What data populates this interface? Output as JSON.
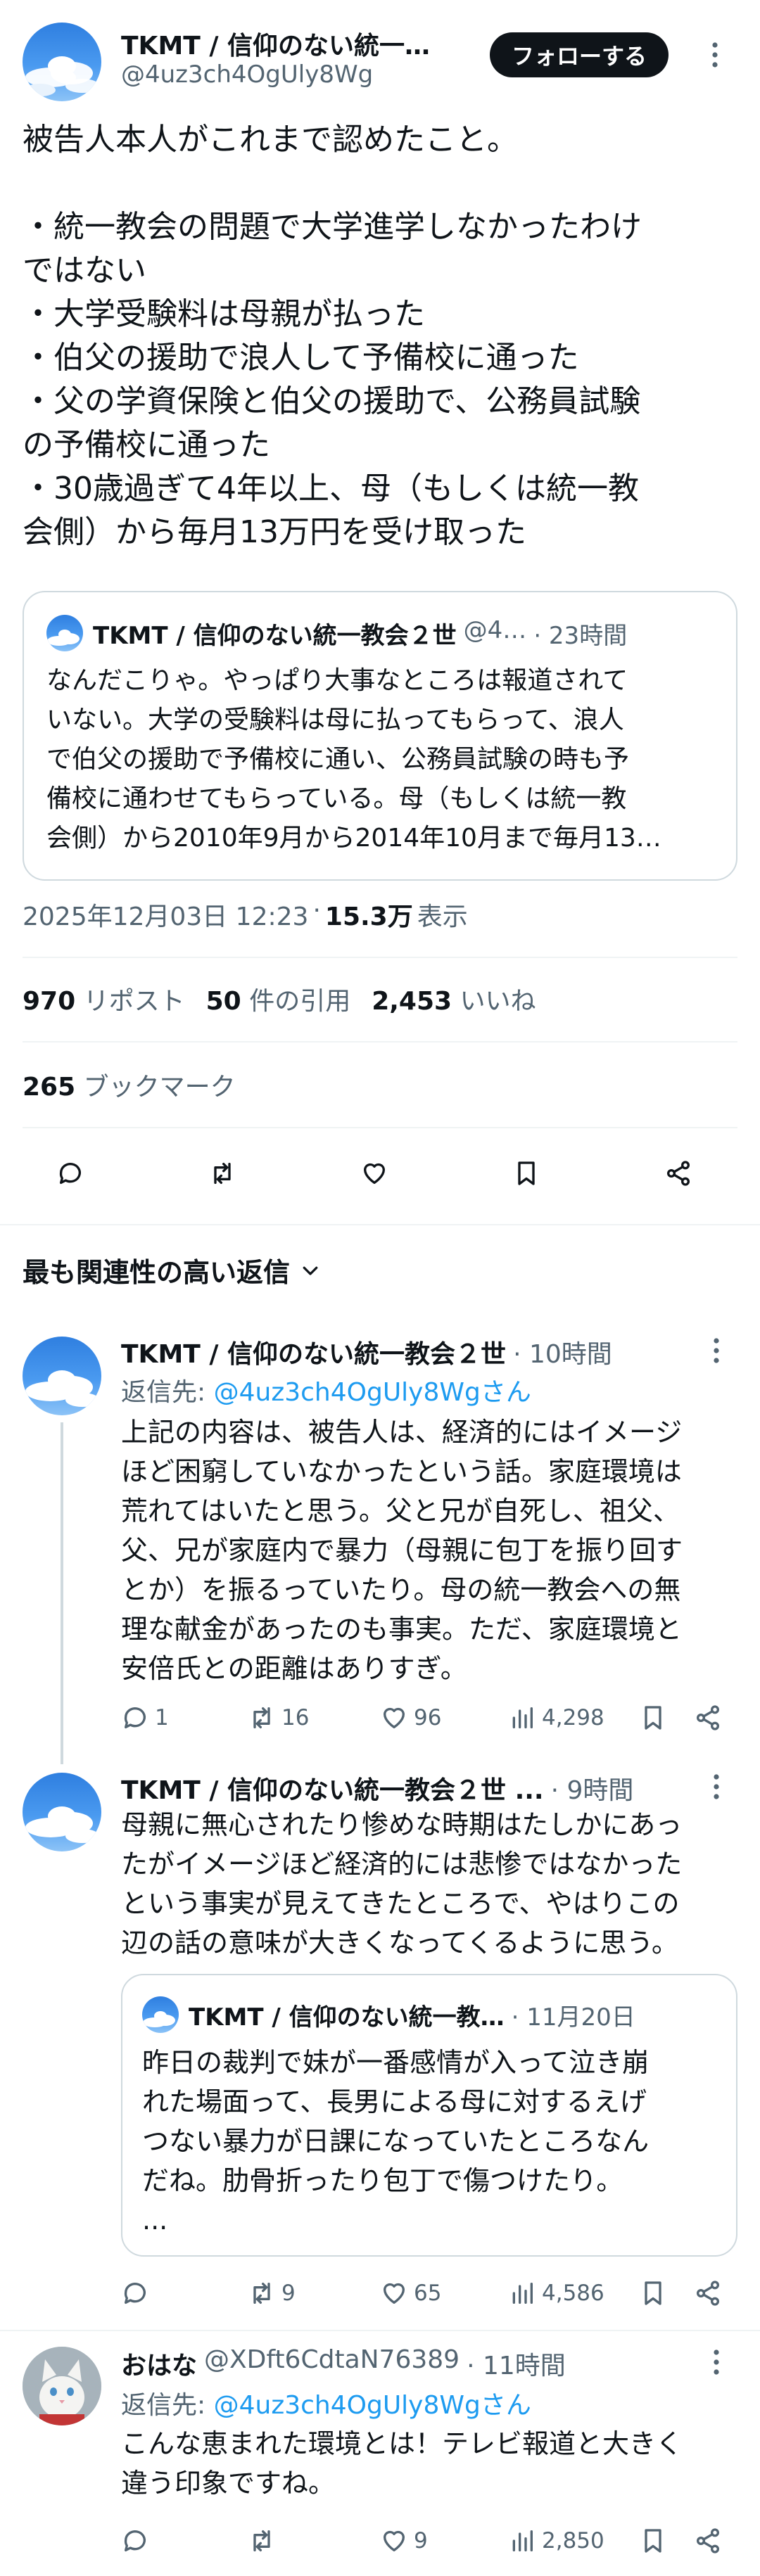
{
  "author": {
    "name": "TKMT / 信仰のない統一…",
    "handle": "@4uz3ch4OgUly8Wg",
    "follow_label": "フォローする"
  },
  "tweet": {
    "lines": [
      "被告人本人がこれまで認めたこと。",
      "",
      "・統一教会の問題で大学進学しなかったわけ",
      "ではない",
      "・大学受験料は母親が払った",
      "・伯父の援助で浪人して予備校に通った",
      "・父の学資保険と伯父の援助で、公務員試験",
      "の予備校に通った",
      "・30歳過ぎて4年以上、母（もしくは統一教",
      "会側）から毎月13万円を受け取った"
    ],
    "quote": {
      "name": "TKMT / 信仰のない統一教会２世",
      "handle": "@4…",
      "time": "· 23時間",
      "lines": [
        "なんだこりゃ。やっぱり大事なところは報道されて",
        "いない。大学の受験料は母に払ってもらって、浪人",
        "で伯父の援助で予備校に通い、公務員試験の時も予",
        "備校に通わせてもらっている。母（もしくは統一教",
        "会側）から2010年9月から2014年10月まで毎月13…"
      ]
    },
    "timestamp": "2025年12月03日 12:23",
    "views_count": "15.3万",
    "views_label": "表示",
    "stats": {
      "reposts": "970",
      "reposts_label": "リポスト",
      "quotes": "50",
      "quotes_label": "件の引用",
      "likes": "2,453",
      "likes_label": "いいね",
      "bookmarks": "265",
      "bookmarks_label": "ブックマーク"
    }
  },
  "replies_header": "最も関連性の高い返信",
  "replies": [
    {
      "name": "TKMT / 信仰のない統一教会２世",
      "time": "· 10時間",
      "reply_to_label": "返信先:",
      "reply_to_handle": "@4uz3ch4OgUly8Wgさん",
      "lines": [
        "上記の内容は、被告人は、経済的にはイメージ",
        "ほど困窮していなかったという話。家庭環境は",
        "荒れてはいたと思う。父と兄が自死し、祖父、",
        "父、兄が家庭内で暴力（母親に包丁を振り回す",
        "とか）を振るっていたり。母の統一教会への無",
        "理な献金があったのも事実。ただ、家庭環境と",
        "安倍氏との距離はありすぎ。"
      ],
      "replies": "1",
      "reposts": "16",
      "likes": "96",
      "views": "4,298"
    },
    {
      "name": "TKMT / 信仰のない統一教会２世 ...",
      "time": "· 9時間",
      "lines": [
        "母親に無心されたり惨めな時期はたしかにあっ",
        "たがイメージほど経済的には悲惨ではなかった",
        "という事実が見えてきたところで、やはりこの",
        "辺の話の意味が大きくなってくるように思う。"
      ],
      "quote": {
        "name": "TKMT / 信仰のない統一教…",
        "time": "· 11月20日",
        "lines": [
          "昨日の裁判で妹が一番感情が入って泣き崩",
          "れた場面って、長男による母に対するえげ",
          "つない暴力が日課になっていたところなん",
          "だね。肋骨折ったり包丁で傷つけたり。",
          "..."
        ]
      },
      "replies": "",
      "reposts": "9",
      "likes": "65",
      "views": "4,586"
    },
    {
      "name": "おはな",
      "handle": "@XDft6CdtaN76389",
      "time": "· 11時間",
      "reply_to_label": "返信先:",
      "reply_to_handle": "@4uz3ch4OgUly8Wgさん",
      "lines": [
        "こんな恵まれた環境とは！テレビ報道と大きく",
        "違う印象ですね。"
      ],
      "replies": "",
      "reposts": "",
      "likes": "9",
      "views": "2,850"
    }
  ]
}
